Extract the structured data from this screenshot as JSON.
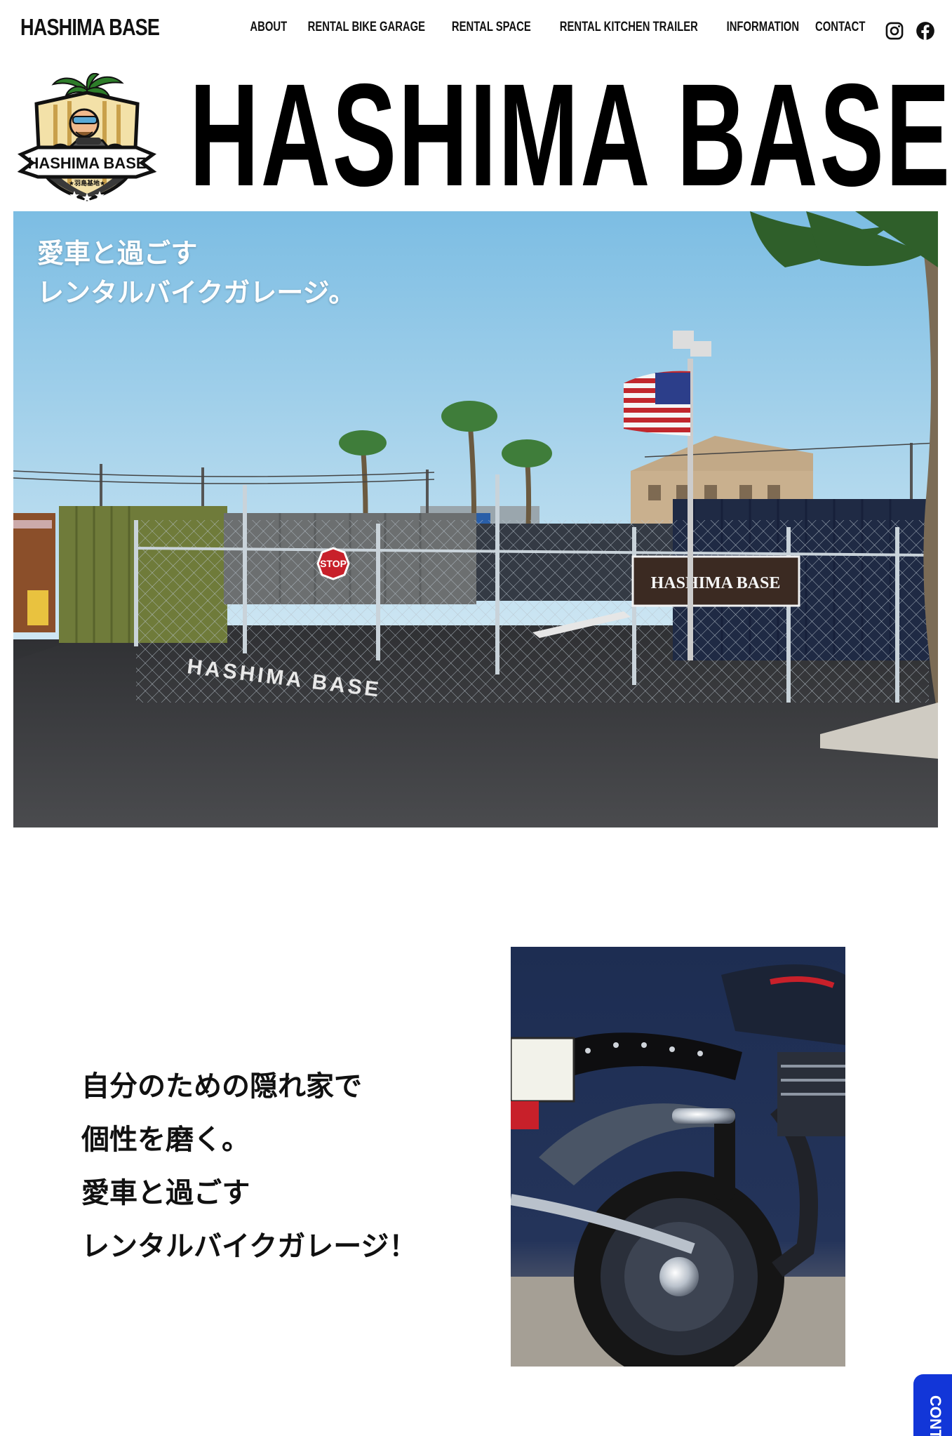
{
  "header": {
    "brand": "HASHIMA BASE",
    "nav": [
      {
        "label": "ABOUT"
      },
      {
        "label": "RENTAL BIKE GARAGE"
      },
      {
        "label": "RENTAL SPACE"
      },
      {
        "label": "RENTAL KITCHEN TRAILER"
      },
      {
        "label": "INFORMATION"
      },
      {
        "label": "CONTACT"
      }
    ],
    "social": [
      "instagram-icon",
      "facebook-icon"
    ]
  },
  "logo": {
    "badge_text": "HASHIMA BASE",
    "badge_subtext": "★羽島基地★",
    "title": "HASHIMA BASE"
  },
  "hero": {
    "catch_line1": "愛車と過ごす",
    "catch_line2": "レンタルバイクガレージ。",
    "sign_text": "HASHIMA BASE",
    "road_text": "HASHIMA BASE",
    "stop_text": "STOP"
  },
  "intro": {
    "lines": [
      "自分のための隠れ家で",
      "個性を磨く。",
      "愛車と過ごす",
      "レンタルバイクガレージ！"
    ]
  },
  "contact_tab": {
    "label": "CONTACT"
  },
  "colors": {
    "sky_top": "#7dbfe4",
    "sky_bottom": "#d9edf6",
    "asphalt": "#3a3a3c",
    "container_green": "#6f7b3a",
    "container_navy": "#1f2a44",
    "contact_blue": "#1236d8"
  }
}
